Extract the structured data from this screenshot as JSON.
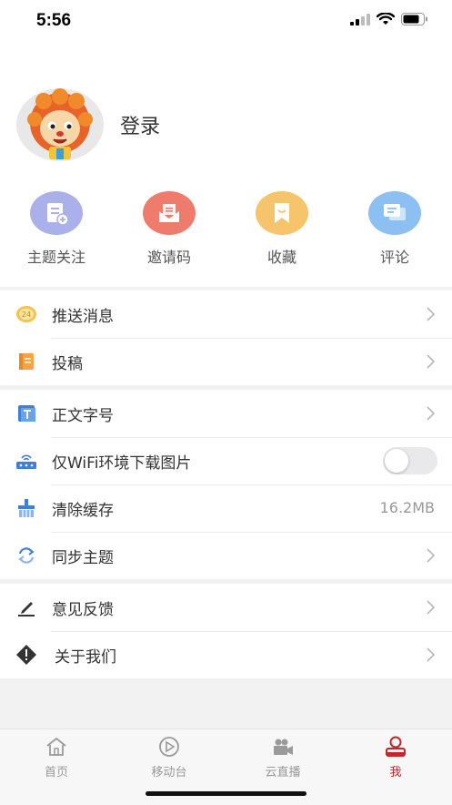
{
  "status_bar": {
    "time": "5:56"
  },
  "profile": {
    "login_label": "登录"
  },
  "quick_actions": [
    {
      "label": "主题关注",
      "icon": "topic-follow-icon",
      "color": "#aab1ea"
    },
    {
      "label": "邀请码",
      "icon": "invite-code-icon",
      "color": "#ee7b6c"
    },
    {
      "label": "收藏",
      "icon": "favorite-icon",
      "color": "#f6c56b"
    },
    {
      "label": "评论",
      "icon": "comment-icon",
      "color": "#8cbff2"
    }
  ],
  "menu_groups": [
    {
      "items": [
        {
          "label": "推送消息",
          "icon": "push-24-icon"
        },
        {
          "label": "投稿",
          "icon": "contribute-icon"
        }
      ]
    },
    {
      "items": [
        {
          "label": "正文字号",
          "icon": "font-size-icon"
        },
        {
          "label": "仅WiFi环境下载图片",
          "icon": "wifi-router-icon",
          "toggle_on": false
        },
        {
          "label": "清除缓存",
          "icon": "broom-icon",
          "value": "16.2MB"
        },
        {
          "label": "同步主题",
          "icon": "sync-icon"
        }
      ]
    },
    {
      "items": [
        {
          "label": "意见反馈",
          "icon": "pencil-icon"
        },
        {
          "label": "关于我们",
          "icon": "info-diamond-icon"
        }
      ]
    }
  ],
  "tab_bar": {
    "tabs": [
      {
        "label": "首页",
        "icon": "home-icon"
      },
      {
        "label": "移动台",
        "icon": "play-icon"
      },
      {
        "label": "云直播",
        "icon": "camera-icon"
      },
      {
        "label": "我",
        "icon": "person-icon",
        "active": true
      }
    ],
    "active_color": "#c0282d"
  }
}
